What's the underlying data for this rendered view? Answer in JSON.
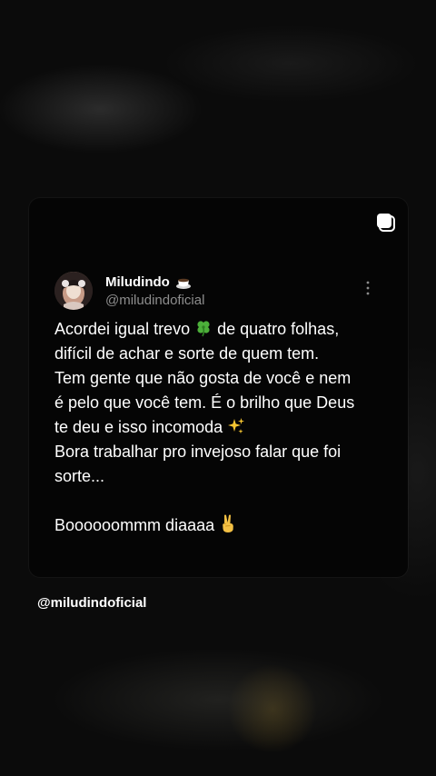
{
  "post": {
    "display_name": "Miludindo",
    "handle": "@miludindoficial",
    "name_emoji": "coffee-cup-icon",
    "lines": {
      "l1a": "Acordei igual trevo ",
      "l1b": " de quatro folhas,",
      "l2": "difícil de achar e sorte de quem tem.",
      "l3": "Tem gente que não gosta de você e nem",
      "l4": "é pelo que você tem. É o brilho que Deus",
      "l5": "te deu e isso incomoda ",
      "l6": "Bora trabalhar pro invejoso falar que foi",
      "l7": "sorte...",
      "l8": "Boooooommm diaaaa "
    },
    "emojis": [
      "four-leaf-clover-icon",
      "sparkles-icon",
      "victory-hand-icon"
    ]
  },
  "footer": {
    "handle": "@miludindoficial"
  },
  "colors": {
    "background": "#0b0b0b",
    "card": "#050505",
    "text": "#ffffff",
    "muted": "#8d8d8d"
  }
}
